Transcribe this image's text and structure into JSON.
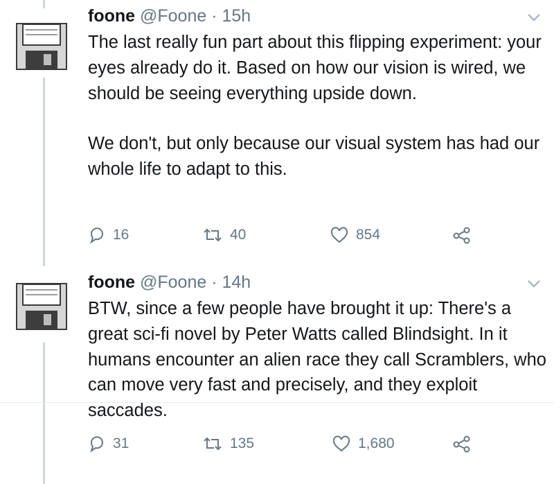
{
  "tweets": [
    {
      "name": "foone",
      "handle": "@Foone",
      "separator": "·",
      "time": "15h",
      "paragraphs": [
        "The last really fun part about this flipping experiment: your eyes already do it. Based on how our vision is wired, we should be seeing everything upside down.",
        "We don't, but only because our visual system has had our whole life to adapt to this."
      ],
      "replies": "16",
      "retweets": "40",
      "likes": "854"
    },
    {
      "name": "foone",
      "handle": "@Foone",
      "separator": "·",
      "time": "14h",
      "paragraphs": [
        "BTW, since a few people have brought it up: There's a great sci-fi novel by Peter Watts called Blindsight. In it humans encounter an alien race they call Scramblers, who can move very fast and precisely, and they exploit saccades."
      ],
      "replies": "31",
      "retweets": "135",
      "likes": "1,680"
    }
  ],
  "icons": {
    "avatar": "floppy-disk-icon",
    "menu": "chevron-down-icon",
    "reply": "reply-icon",
    "retweet": "retweet-icon",
    "like": "heart-icon",
    "share": "share-icon"
  },
  "colors": {
    "text": "#14171a",
    "secondary": "#657786",
    "thread_line": "#ccd6dd"
  }
}
